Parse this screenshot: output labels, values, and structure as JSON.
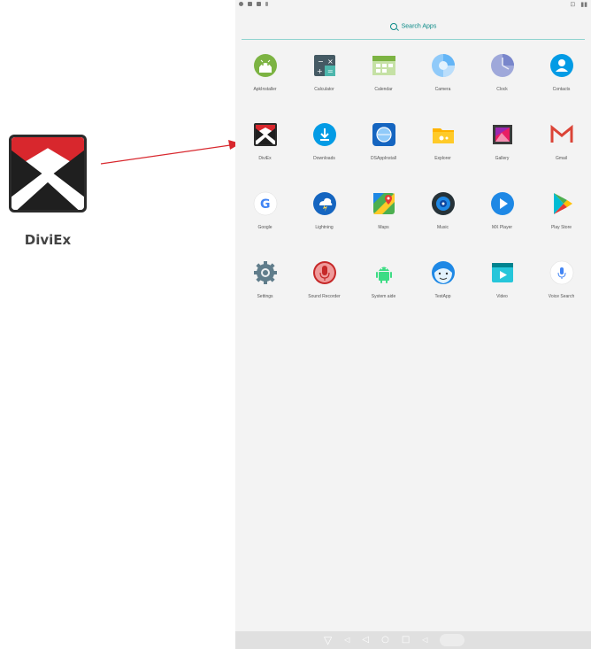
{
  "callout": {
    "label": "DiviEx"
  },
  "statusbar": {
    "right_a": "⊡",
    "right_b": "▮▮"
  },
  "search": {
    "placeholder": "Search Apps"
  },
  "apps": [
    [
      "ApkInstaller",
      "Calculator",
      "Calendar",
      "Camera",
      "Clock",
      "Contacts"
    ],
    [
      "DiviEx",
      "Downloads",
      "DSAppInstall",
      "Explorer",
      "Gallery",
      "Gmail"
    ],
    [
      "Google",
      "Lightning",
      "Maps",
      "Music",
      "MX Player",
      "Play Store"
    ],
    [
      "Settings",
      "Sound Recorder",
      "System aide",
      "TestApp",
      "Video",
      "Voice Search"
    ]
  ],
  "navbar": {
    "back": "▽",
    "vol_down": "◁",
    "nav_back": "◁",
    "home": "○",
    "recents": "□",
    "vol_up": "◁"
  },
  "colors": {
    "accent": "#0b8a87",
    "diviex_red": "#d8272d"
  }
}
